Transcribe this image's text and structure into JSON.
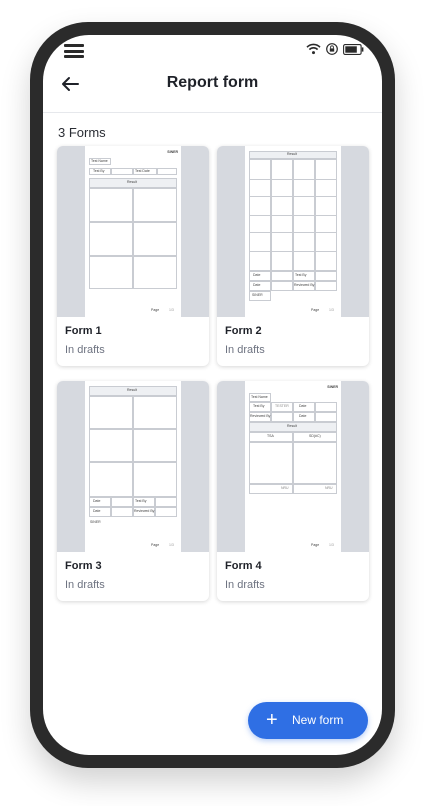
{
  "header": {
    "title": "Report form"
  },
  "forms_count": "3 Forms",
  "forms": [
    {
      "name": "Form 1",
      "status": "In drafts",
      "preview": {
        "logo": "SINER",
        "test_name": "Test Name",
        "test_by": "Test By",
        "test_date": "Test Date",
        "result": "Result",
        "page": "Page",
        "page_num": "1/3"
      }
    },
    {
      "name": "Form 2",
      "status": "In drafts",
      "preview": {
        "result": "Result",
        "date": "Date",
        "test_by": "Test By",
        "date2": "Date",
        "reviewed_by": "Reviewed By",
        "logo": "SINER",
        "page": "Page",
        "page_num": "1/3"
      }
    },
    {
      "name": "Form 3",
      "status": "In drafts",
      "preview": {
        "result": "Result",
        "date": "Date",
        "test_by": "Test By",
        "date2": "Date",
        "reviewed_by": "Reviewed By",
        "logo": "SINER",
        "page": "Page",
        "page_num": "1/3"
      }
    },
    {
      "name": "Form 4",
      "status": "In drafts",
      "preview": {
        "logo": "SINER",
        "test_name": "Test Name",
        "test_by": "Test By",
        "tester": "TESTER",
        "date": "Date",
        "reviewed_by": "Reviewed By",
        "date2": "Date",
        "result": "Result",
        "col_a": "TSA",
        "col_b": "SD(#C)",
        "val_a": "NRU",
        "val_b": "NRU",
        "page": "Page",
        "page_num": "1/3"
      }
    }
  ],
  "fab": {
    "label": "New form"
  },
  "icons": [
    "menu-icon",
    "wifi-icon",
    "lock-icon",
    "battery-icon",
    "back-arrow-icon",
    "plus-icon"
  ],
  "colors": {
    "accent": "#2f6fe4",
    "preview_bg": "#d6d9df",
    "phone_frame": "#2b2b2b"
  }
}
